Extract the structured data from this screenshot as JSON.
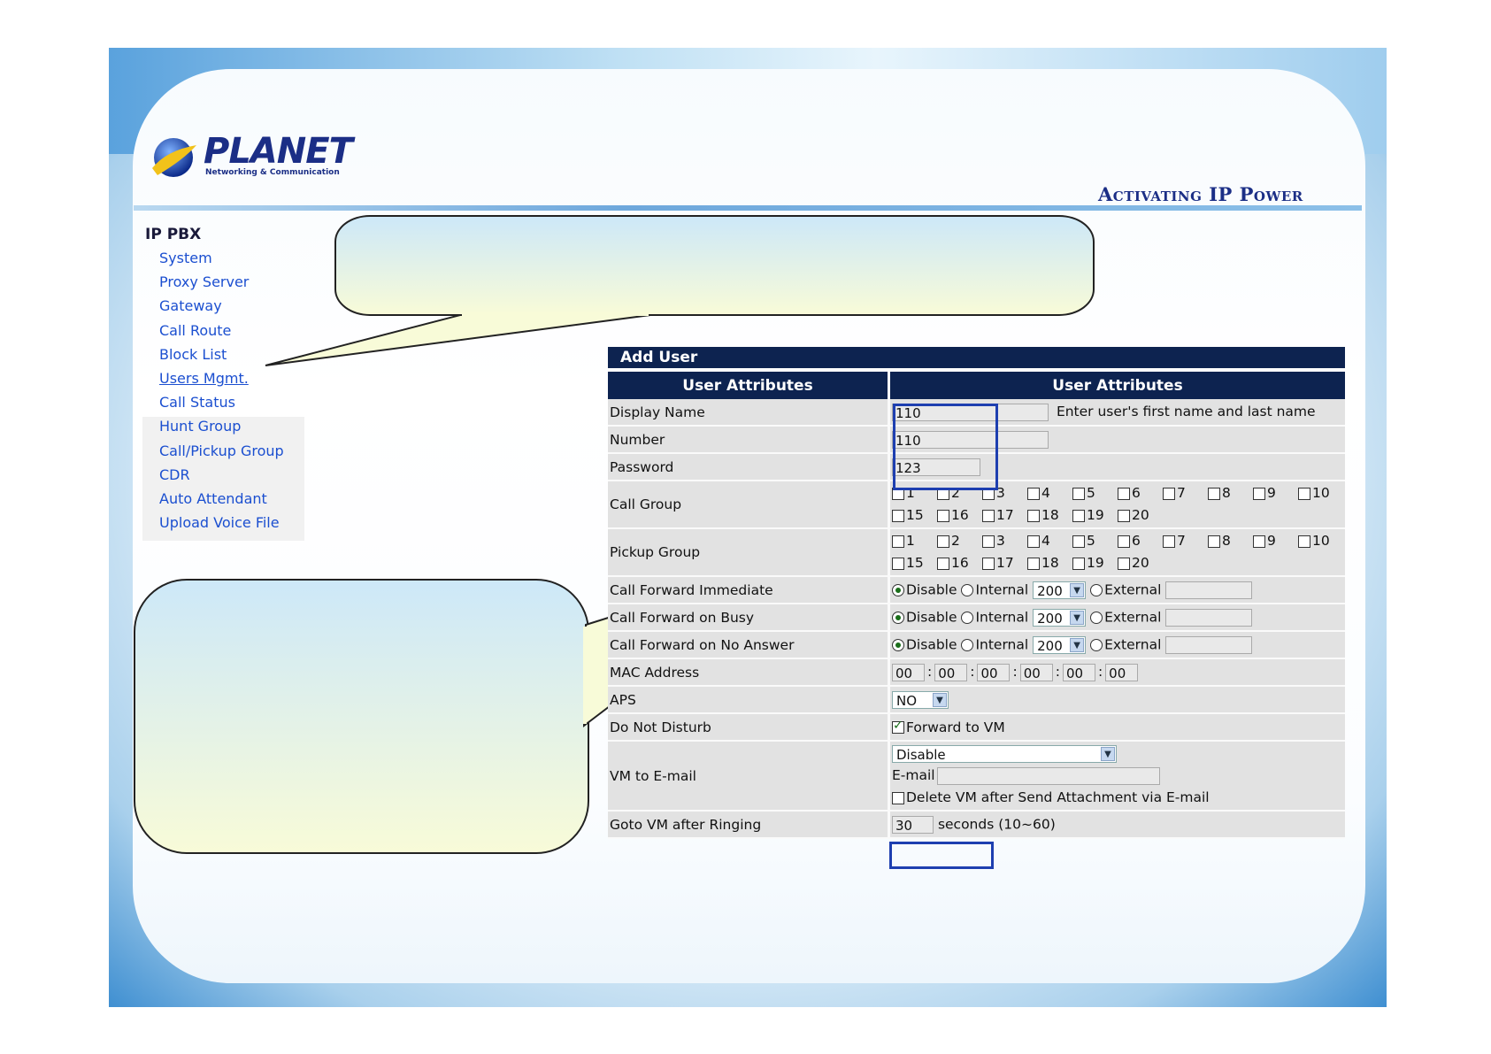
{
  "brand": {
    "logo_text": "PLANET",
    "logo_sub": "Networking & Communication",
    "tagline": "Activating IP Power"
  },
  "sidebar": {
    "title": "IP PBX",
    "items": [
      {
        "label": "System"
      },
      {
        "label": "Proxy Server"
      },
      {
        "label": "Gateway"
      },
      {
        "label": "Call Route"
      },
      {
        "label": "Block List"
      },
      {
        "label": "Users Mgmt.",
        "active": true
      },
      {
        "label": "Call Status"
      },
      {
        "label": "Hunt Group"
      },
      {
        "label": "Call/Pickup Group"
      },
      {
        "label": "CDR"
      },
      {
        "label": "Auto Attendant"
      },
      {
        "label": "Upload Voice File"
      }
    ]
  },
  "form": {
    "title": "Add User",
    "header_left": "User Attributes",
    "header_right": "User Attributes",
    "display_name": {
      "label": "Display Name",
      "value": "110",
      "hint": "Enter user's first name and last name"
    },
    "number": {
      "label": "Number",
      "value": "110"
    },
    "password": {
      "label": "Password",
      "value": "123"
    },
    "call_group": {
      "label": "Call Group",
      "row1": [
        "1",
        "2",
        "3",
        "4",
        "5",
        "6",
        "7",
        "8",
        "9",
        "10"
      ],
      "row2": [
        "15",
        "16",
        "17",
        "18",
        "19",
        "20"
      ]
    },
    "pickup_group": {
      "label": "Pickup Group",
      "row1": [
        "1",
        "2",
        "3",
        "4",
        "5",
        "6",
        "7",
        "8",
        "9",
        "10"
      ],
      "row2": [
        "15",
        "16",
        "17",
        "18",
        "19",
        "20"
      ]
    },
    "forward_rows": [
      {
        "label": "Call Forward Immediate",
        "disable": "Disable",
        "internal": "Internal",
        "internal_value": "200",
        "external": "External"
      },
      {
        "label": "Call Forward on Busy",
        "disable": "Disable",
        "internal": "Internal",
        "internal_value": "200",
        "external": "External"
      },
      {
        "label": "Call Forward on No Answer",
        "disable": "Disable",
        "internal": "Internal",
        "internal_value": "200",
        "external": "External"
      }
    ],
    "mac": {
      "label": "MAC Address",
      "octets": [
        "00",
        "00",
        "00",
        "00",
        "00",
        "00"
      ],
      "separator": ":"
    },
    "aps": {
      "label": "APS",
      "value": "NO"
    },
    "dnd": {
      "label": "Do Not Disturb",
      "option": "Forward to VM",
      "checked": true
    },
    "vm_email": {
      "label": "VM to E-mail",
      "select": "Disable",
      "email_label": "E-mail",
      "email_value": "",
      "delete_label": "Delete VM after Send Attachment via E-mail",
      "delete_checked": false
    },
    "goto_vm": {
      "label": "Goto VM after Ringing",
      "value": "30",
      "unit": "seconds",
      "range": "(10~60)"
    }
  },
  "colors": {
    "header_bg": "#0d2350",
    "row_bg": "#e2e2e2",
    "link": "#1b4fd0",
    "highlight": "#1e3fb0"
  }
}
